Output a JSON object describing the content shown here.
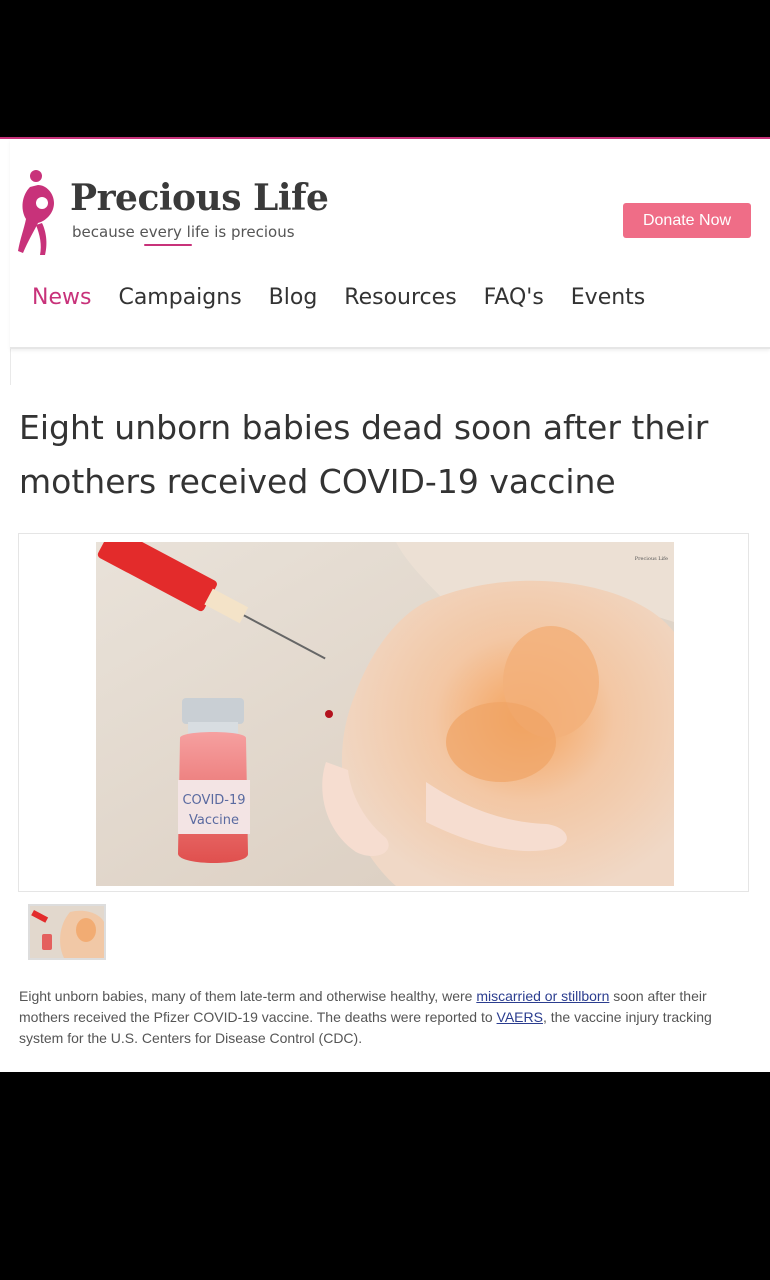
{
  "site": {
    "logo_title": "Precious Life",
    "logo_tagline": "because every life is precious",
    "donate_label": "Donate Now",
    "accent_color": "#c8327a",
    "donate_color": "#ef6d87"
  },
  "nav": {
    "items": [
      "News",
      "Campaigns",
      "Blog",
      "Resources",
      "FAQ's",
      "Events"
    ],
    "active": "News"
  },
  "article": {
    "title": "Eight unborn babies dead soon after their mothers received COVID-19 vaccine",
    "image_text": {
      "vial_label_line1": "COVID-19",
      "vial_label_line2": "Vaccine",
      "watermark": "Precious Life"
    },
    "paragraph": {
      "part1": "Eight unborn babies, many of them late-term and otherwise healthy, were ",
      "link1": "miscarried or stillborn",
      "part2": " soon after their mothers received the Pfizer COVID-19 vaccine. The deaths were reported to ",
      "link2": "VAERS",
      "part3": ", the vaccine injury tracking system for the U.S. Centers for Disease Control (CDC)."
    }
  }
}
